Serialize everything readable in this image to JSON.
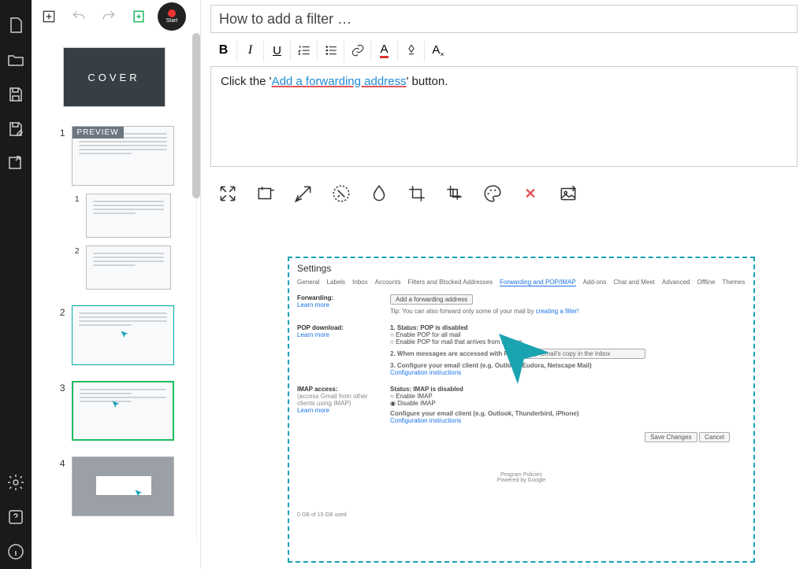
{
  "left_rail": {
    "icons": [
      "document",
      "folder-open",
      "save",
      "save-as",
      "export",
      "gear",
      "help",
      "info"
    ]
  },
  "top_tools": {
    "start_label": "Start"
  },
  "thumbs": {
    "cover_label": "COVER",
    "preview_badge": "PREVIEW",
    "steps": [
      {
        "num": "1",
        "children": 2,
        "preview": true
      },
      {
        "num": "2",
        "children": 0
      },
      {
        "num": "3",
        "children": 0,
        "selected": true
      },
      {
        "num": "4",
        "children": 0,
        "grey": true
      }
    ],
    "substeps": [
      "1",
      "2"
    ]
  },
  "editor": {
    "title_placeholder": "How to add a filter …",
    "description_pre": "Click the '",
    "description_link": "Add a forwarding address",
    "description_post": "' button."
  },
  "format_bar": {
    "items": [
      "bold",
      "italic",
      "underline",
      "ordered-list",
      "unordered-list",
      "link",
      "text-color",
      "highlight",
      "clear-format"
    ]
  },
  "image_tools": {
    "items": [
      "expand",
      "rectangle",
      "arrow",
      "spotlight",
      "blur",
      "crop",
      "multi-crop",
      "palette",
      "delete",
      "replace-image"
    ]
  },
  "settings_mock": {
    "title": "Settings",
    "tabs": [
      "General",
      "Labels",
      "Inbox",
      "Accounts",
      "Filters and Blocked Addresses",
      "Forwarding and POP/IMAP",
      "Add-ons",
      "Chat and Meet",
      "Advanced",
      "Offline",
      "Themes"
    ],
    "active_tab": "Forwarding and POP/IMAP",
    "forwarding_label": "Forwarding:",
    "learn_more": "Learn more",
    "add_fwd_btn": "Add a forwarding address",
    "tip": "Tip: You can also forward only some of your mail by ",
    "tip_link": "creating a filter!",
    "pop_label": "POP download:",
    "pop_status": "1. Status: POP is disabled",
    "pop_opt1": "Enable POP for all mail",
    "pop_opt2": "Enable POP for mail that arrives from now on",
    "pop_msg": "2. When messages are accessed with POP",
    "pop_select": "keep Gmail's copy in the Inbox",
    "pop_cfg": "3. Configure your email client (e.g. Outlook, Eudora, Netscape Mail)",
    "cfg_link": "Configuration instructions",
    "imap_label": "IMAP access:",
    "imap_sub": "(access Gmail from other clients using IMAP)",
    "imap_status": "Status: IMAP is disabled",
    "imap_opt1": "Enable IMAP",
    "imap_opt2": "Disable IMAP",
    "imap_cfg": "Configure your email client (e.g. Outlook, Thunderbird, iPhone)",
    "save_btn": "Save Changes",
    "cancel_btn": "Cancel",
    "usage": "0 GB of 15 GB used",
    "policies": "Program Policies",
    "powered": "Powered by Google"
  }
}
